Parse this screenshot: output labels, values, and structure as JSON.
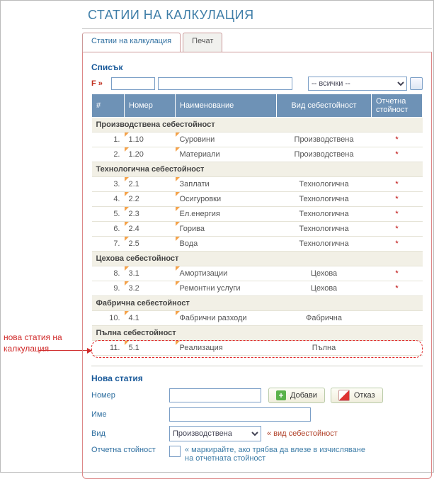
{
  "page_title": "СТАТИИ НА КАЛКУЛАЦИЯ",
  "tabs": [
    {
      "label": "Статии на калкулация",
      "active": true
    },
    {
      "label": "Печат",
      "active": false
    }
  ],
  "list": {
    "title": "Списък",
    "filter_label": "F »",
    "filter_select_value": "-- всички --",
    "columns": {
      "idx": "#",
      "num": "Номер",
      "name": "Наименование",
      "kind": "Вид себестойност",
      "acct": "Отчетна стойност"
    },
    "groups": [
      {
        "title": "Производствена себестойност",
        "rows": [
          {
            "idx": "1.",
            "num": "1.10",
            "name": "Суровини",
            "kind": "Производствена",
            "mark": "*"
          },
          {
            "idx": "2.",
            "num": "1.20",
            "name": "Материали",
            "kind": "Производствена",
            "mark": "*"
          }
        ]
      },
      {
        "title": "Технологична себестойност",
        "rows": [
          {
            "idx": "3.",
            "num": "2.1",
            "name": "Заплати",
            "kind": "Технологична",
            "mark": "*"
          },
          {
            "idx": "4.",
            "num": "2.2",
            "name": "Осигуровки",
            "kind": "Технологична",
            "mark": "*"
          },
          {
            "idx": "5.",
            "num": "2.3",
            "name": "Ел.енергия",
            "kind": "Технологична",
            "mark": "*"
          },
          {
            "idx": "6.",
            "num": "2.4",
            "name": "Горива",
            "kind": "Технологична",
            "mark": "*"
          },
          {
            "idx": "7.",
            "num": "2.5",
            "name": "Вода",
            "kind": "Технологична",
            "mark": "*"
          }
        ]
      },
      {
        "title": "Цехова себестойност",
        "rows": [
          {
            "idx": "8.",
            "num": "3.1",
            "name": "Амортизации",
            "kind": "Цехова",
            "mark": "*"
          },
          {
            "idx": "9.",
            "num": "3.2",
            "name": "Ремонтни услуги",
            "kind": "Цехова",
            "mark": "*"
          }
        ]
      },
      {
        "title": "Фабрична себестойност",
        "rows": [
          {
            "idx": "10.",
            "num": "4.1",
            "name": "Фабрични разходи",
            "kind": "Фабрична",
            "mark": ""
          }
        ]
      },
      {
        "title": "Пълна себестойност",
        "rows": [
          {
            "idx": "11.",
            "num": "5.1",
            "name": "Реализация",
            "kind": "Пълна",
            "mark": "",
            "highlight": true
          }
        ]
      }
    ]
  },
  "annotation": "нова статия на калкулация",
  "new_item": {
    "title": "Нова статия",
    "labels": {
      "num": "Номер",
      "name": "Име",
      "kind": "Вид",
      "acct": "Отчетна стойност"
    },
    "kind_value": "Производствена",
    "kind_hint": "« вид себестойност",
    "acct_hint": "« маркирайте, ако трябва да влезе в изчисляване на отчетната стойност",
    "add_label": "Добави",
    "cancel_label": "Отказ"
  }
}
